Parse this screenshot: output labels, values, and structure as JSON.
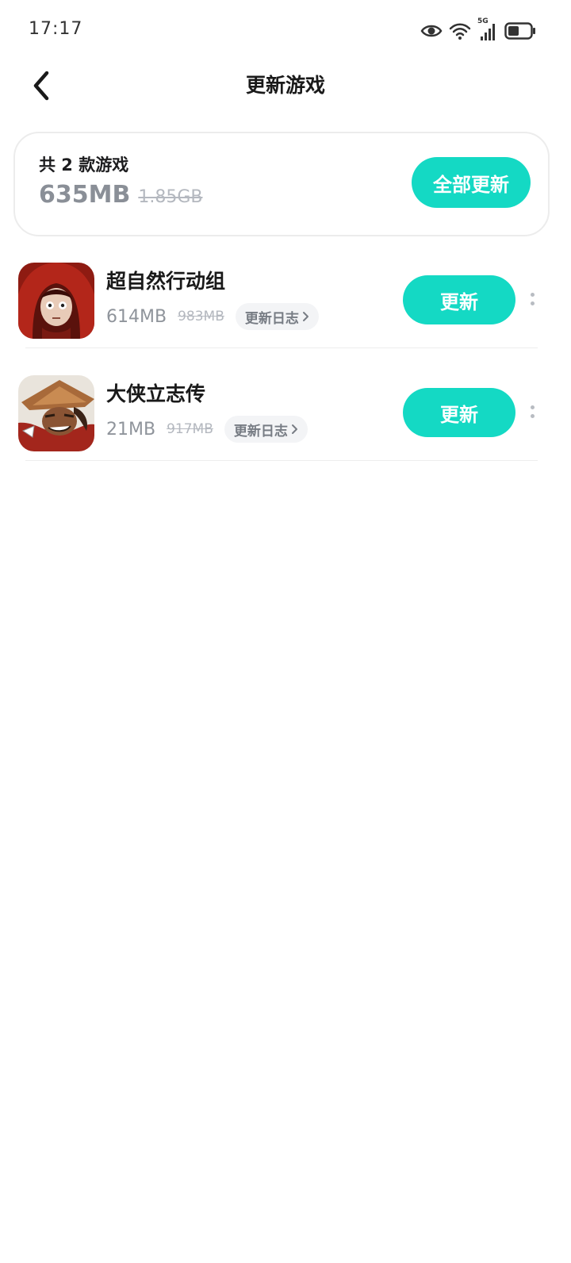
{
  "status_bar": {
    "time": "17:17",
    "network_label": "5G",
    "icons": [
      "eye-icon",
      "wifi-icon",
      "cellular-signal-icon",
      "battery-icon"
    ]
  },
  "header": {
    "title": "更新游戏",
    "back_icon": "chevron-left-icon"
  },
  "summary": {
    "count_text": "共 2 款游戏",
    "new_size": "635MB",
    "old_size": "1.85GB",
    "update_all_label": "全部更新"
  },
  "games": [
    {
      "name": "超自然行动组",
      "new_size": "614MB",
      "old_size": "983MB",
      "changelog_label": "更新日志",
      "update_label": "更新"
    },
    {
      "name": "大侠立志传",
      "new_size": "21MB",
      "old_size": "917MB",
      "changelog_label": "更新日志",
      "update_label": "更新"
    }
  ],
  "colors": {
    "accent": "#14d9c4",
    "muted_text": "#8f949b",
    "strike_text": "#b4b8bf"
  }
}
